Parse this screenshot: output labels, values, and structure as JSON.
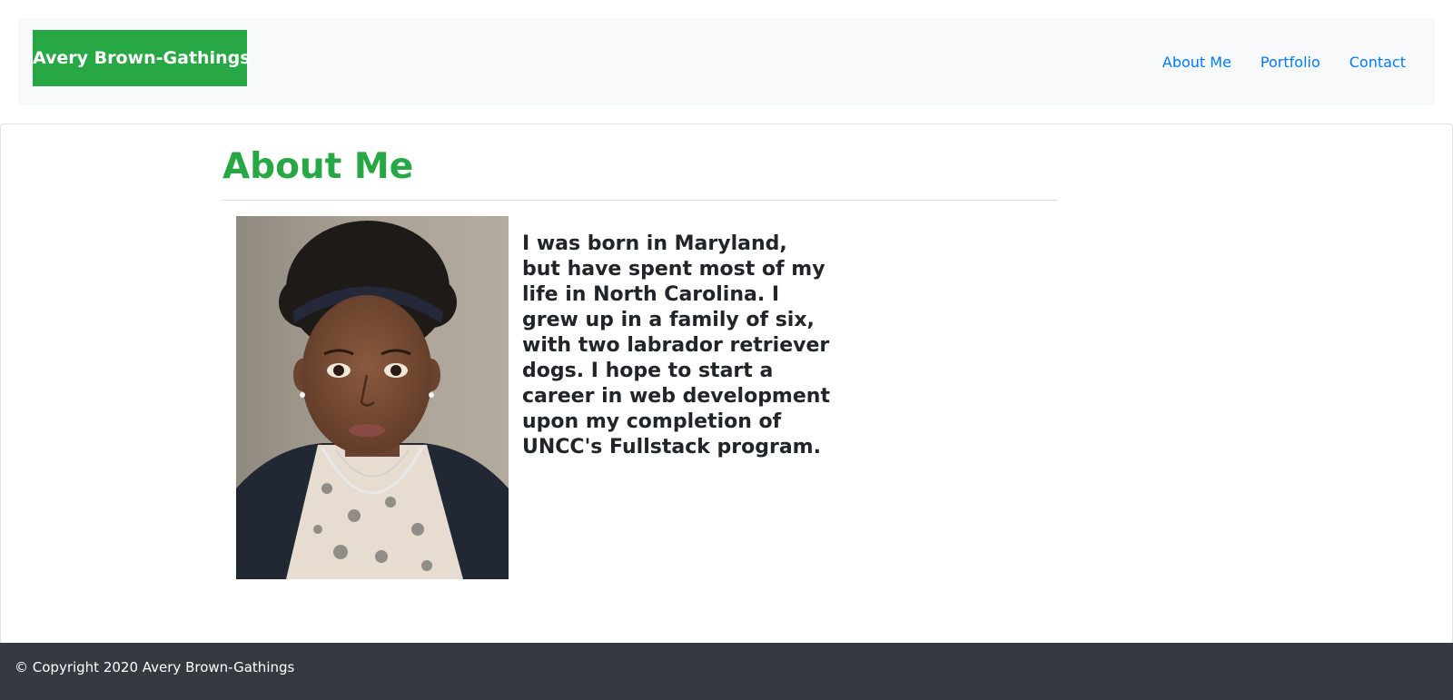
{
  "navbar": {
    "brand": "Avery Brown-Gathings",
    "links": [
      "About Me",
      "Portfolio",
      "Contact"
    ]
  },
  "main": {
    "title": "About Me",
    "bio": "I was born in Maryland, but have spent most of my life in North Carolina. I grew up in a family of six, with two labrador retriever dogs. I hope to start a career in web development upon my completion of UNCC's Fullstack program."
  },
  "footer": {
    "copyright": "© Copyright 2020 Avery Brown-Gathings"
  },
  "colors": {
    "brand_green": "#28a745",
    "link_blue": "#007bff",
    "navbar_bg": "#f8f9fa",
    "footer_bg": "#343a40",
    "text_dark": "#212529"
  }
}
